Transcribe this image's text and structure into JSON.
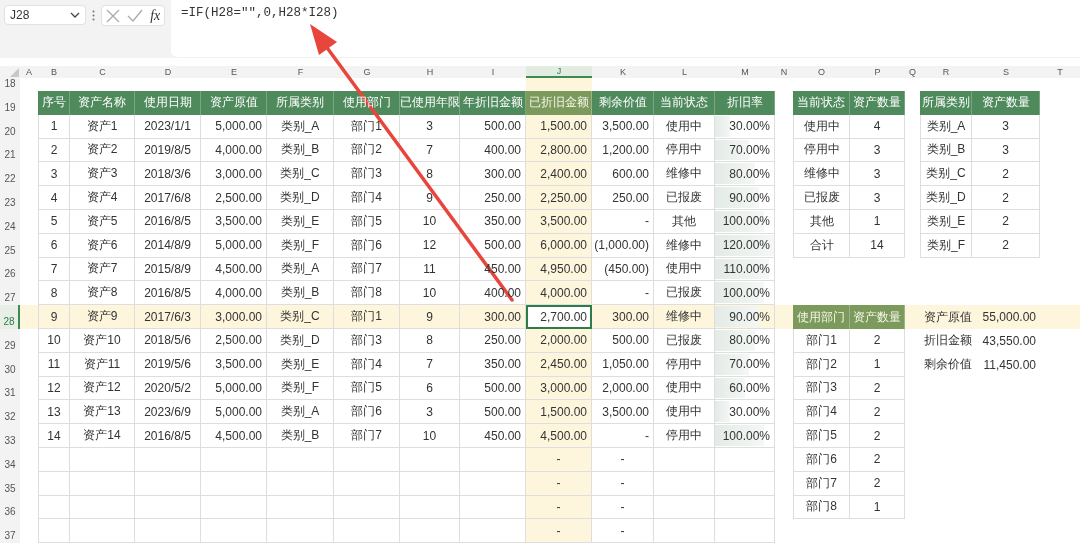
{
  "formula_bar": {
    "cell_ref": "J28",
    "fx": "fx",
    "formula": "=IF(H28=\"\",0,H28*I28)"
  },
  "column_headers": [
    {
      "label": "A",
      "selected": false
    },
    {
      "label": "B",
      "selected": false
    },
    {
      "label": "C",
      "selected": false
    },
    {
      "label": "D",
      "selected": false
    },
    {
      "label": "E",
      "selected": false
    },
    {
      "label": "F",
      "selected": false
    },
    {
      "label": "G",
      "selected": false
    },
    {
      "label": "H",
      "selected": false
    },
    {
      "label": "I",
      "selected": false
    },
    {
      "label": "J",
      "selected": true
    },
    {
      "label": "K",
      "selected": false
    },
    {
      "label": "L",
      "selected": false
    },
    {
      "label": "M",
      "selected": false
    },
    {
      "label": "N",
      "selected": false
    },
    {
      "label": "O",
      "selected": false
    },
    {
      "label": "P",
      "selected": false
    },
    {
      "label": "Q",
      "selected": false
    },
    {
      "label": "R",
      "selected": false
    },
    {
      "label": "S",
      "selected": false
    },
    {
      "label": "T",
      "selected": false
    }
  ],
  "row_headers": [
    {
      "label": "18",
      "selected": false
    },
    {
      "label": "19",
      "selected": false
    },
    {
      "label": "20",
      "selected": false
    },
    {
      "label": "21",
      "selected": false
    },
    {
      "label": "22",
      "selected": false
    },
    {
      "label": "23",
      "selected": false
    },
    {
      "label": "24",
      "selected": false
    },
    {
      "label": "25",
      "selected": false
    },
    {
      "label": "26",
      "selected": false
    },
    {
      "label": "27",
      "selected": false
    },
    {
      "label": "28",
      "selected": true
    },
    {
      "label": "29",
      "selected": false
    },
    {
      "label": "30",
      "selected": false
    },
    {
      "label": "31",
      "selected": false
    },
    {
      "label": "32",
      "selected": false
    },
    {
      "label": "33",
      "selected": false
    },
    {
      "label": "34",
      "selected": false
    },
    {
      "label": "35",
      "selected": false
    },
    {
      "label": "36",
      "selected": false
    },
    {
      "label": "37",
      "selected": false
    }
  ],
  "asset_table": {
    "columns": [
      "序号",
      "资产名称",
      "使用日期",
      "资产原值",
      "所属类别",
      "使用部门",
      "已使用年限",
      "年折旧金额",
      "已折旧金额",
      "剩余价值",
      "当前状态",
      "折旧率"
    ],
    "rows": [
      {
        "cells": [
          "1",
          "资产1",
          "2023/1/1",
          "5,000.00",
          "类别_A",
          "部门1",
          "3",
          "500.00",
          "1,500.00",
          "3,500.00",
          "使用中",
          "30.00%"
        ],
        "level": 0.25
      },
      {
        "cells": [
          "2",
          "资产2",
          "2019/8/5",
          "4,000.00",
          "类别_B",
          "部门2",
          "7",
          "400.00",
          "2,800.00",
          "1,200.00",
          "停用中",
          "70.00%"
        ],
        "level": 0.58
      },
      {
        "cells": [
          "3",
          "资产3",
          "2018/3/6",
          "3,000.00",
          "类别_C",
          "部门3",
          "8",
          "300.00",
          "2,400.00",
          "600.00",
          "维修中",
          "80.00%"
        ],
        "level": 0.67
      },
      {
        "cells": [
          "4",
          "资产4",
          "2017/6/8",
          "2,500.00",
          "类别_D",
          "部门4",
          "9",
          "250.00",
          "2,250.00",
          "250.00",
          "已报废",
          "90.00%"
        ],
        "level": 0.75
      },
      {
        "cells": [
          "5",
          "资产5",
          "2016/8/5",
          "3,500.00",
          "类别_E",
          "部门5",
          "10",
          "350.00",
          "3,500.00",
          "-",
          "其他",
          "100.00%"
        ],
        "level": 0.83
      },
      {
        "cells": [
          "6",
          "资产6",
          "2014/8/9",
          "5,000.00",
          "类别_F",
          "部门6",
          "12",
          "500.00",
          "6,000.00",
          "(1,000.00)",
          "维修中",
          "120.00%"
        ],
        "level": 1
      },
      {
        "cells": [
          "7",
          "资产7",
          "2015/8/9",
          "4,500.00",
          "类别_A",
          "部门7",
          "11",
          "450.00",
          "4,950.00",
          "(450.00)",
          "使用中",
          "110.00%"
        ],
        "level": 0.92
      },
      {
        "cells": [
          "8",
          "资产8",
          "2016/8/5",
          "4,000.00",
          "类别_B",
          "部门8",
          "10",
          "400.00",
          "4,000.00",
          "-",
          "已报废",
          "100.00%"
        ],
        "level": 0.83
      },
      {
        "cells": [
          "9",
          "资产9",
          "2017/6/3",
          "3,000.00",
          "类别_C",
          "部门1",
          "9",
          "300.00",
          "2,700.00",
          "300.00",
          "维修中",
          "90.00%"
        ],
        "level": 0.75
      },
      {
        "cells": [
          "10",
          "资产10",
          "2018/5/6",
          "2,500.00",
          "类别_D",
          "部门3",
          "8",
          "250.00",
          "2,000.00",
          "500.00",
          "已报废",
          "80.00%"
        ],
        "level": 0.67
      },
      {
        "cells": [
          "11",
          "资产11",
          "2019/5/6",
          "3,500.00",
          "类别_E",
          "部门4",
          "7",
          "350.00",
          "2,450.00",
          "1,050.00",
          "停用中",
          "70.00%"
        ],
        "level": 0.58
      },
      {
        "cells": [
          "12",
          "资产12",
          "2020/5/2",
          "5,000.00",
          "类别_F",
          "部门5",
          "6",
          "500.00",
          "3,000.00",
          "2,000.00",
          "使用中",
          "60.00%"
        ],
        "level": 0.5
      },
      {
        "cells": [
          "13",
          "资产13",
          "2023/6/9",
          "5,000.00",
          "类别_A",
          "部门6",
          "3",
          "500.00",
          "1,500.00",
          "3,500.00",
          "使用中",
          "30.00%"
        ],
        "level": 0.25
      },
      {
        "cells": [
          "14",
          "资产14",
          "2016/8/5",
          "4,500.00",
          "类别_B",
          "部门7",
          "10",
          "450.00",
          "4,500.00",
          "-",
          "停用中",
          "100.00%"
        ],
        "level": 0.83
      }
    ],
    "blank_rows": [
      {
        "depreciated": "-",
        "remaining": "-"
      },
      {
        "depreciated": "-",
        "remaining": "-"
      },
      {
        "depreciated": "-",
        "remaining": "-"
      },
      {
        "depreciated": "-",
        "remaining": "-"
      }
    ]
  },
  "status_table": {
    "columns": [
      "当前状态",
      "资产数量"
    ],
    "rows": [
      [
        "使用中",
        "4"
      ],
      [
        "停用中",
        "3"
      ],
      [
        "维修中",
        "3"
      ],
      [
        "已报废",
        "3"
      ],
      [
        "其他",
        "1"
      ],
      [
        "合计",
        "14"
      ]
    ]
  },
  "category_table": {
    "columns": [
      "所属类别",
      "资产数量"
    ],
    "rows": [
      [
        "类别_A",
        "3"
      ],
      [
        "类别_B",
        "3"
      ],
      [
        "类别_C",
        "2"
      ],
      [
        "类别_D",
        "2"
      ],
      [
        "类别_E",
        "2"
      ],
      [
        "类别_F",
        "2"
      ]
    ]
  },
  "department_table": {
    "columns": [
      "使用部门",
      "资产数量"
    ],
    "rows": [
      [
        "部门1",
        "2"
      ],
      [
        "部门2",
        "1"
      ],
      [
        "部门3",
        "2"
      ],
      [
        "部门4",
        "2"
      ],
      [
        "部门5",
        "2"
      ],
      [
        "部门6",
        "2"
      ],
      [
        "部门7",
        "2"
      ],
      [
        "部门8",
        "1"
      ]
    ]
  },
  "summary": [
    {
      "label": "资产原值",
      "value": "55,000.00"
    },
    {
      "label": "折旧金额",
      "value": "43,550.00"
    },
    {
      "label": "剩余价值",
      "value": "11,450.00"
    }
  ]
}
